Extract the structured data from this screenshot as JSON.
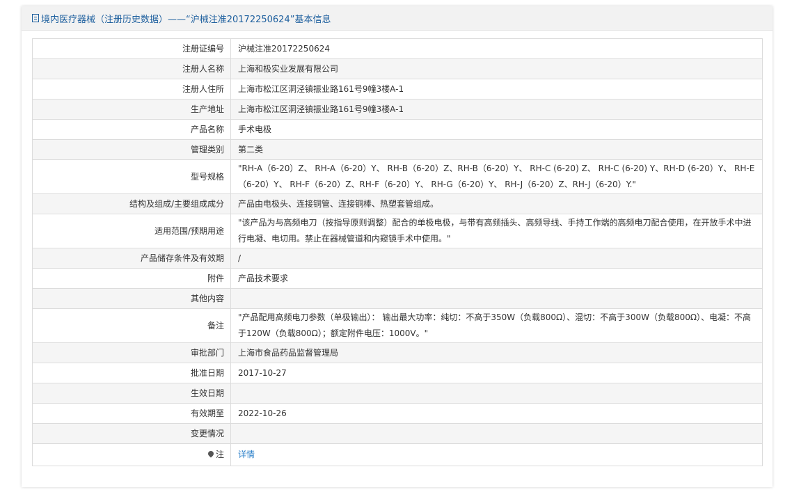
{
  "header": {
    "title": "境内医疗器械（注册历史数据）——“沪械注准20172250624”基本信息"
  },
  "rows": [
    {
      "label": "注册证编号",
      "value": "沪械注准20172250624"
    },
    {
      "label": "注册人名称",
      "value": "上海和极实业发展有限公司"
    },
    {
      "label": "注册人住所",
      "value": "上海市松江区洞泾镇振业路161号9幢3楼A-1"
    },
    {
      "label": "生产地址",
      "value": "上海市松江区洞泾镇振业路161号9幢3楼A-1"
    },
    {
      "label": "产品名称",
      "value": "手术电极"
    },
    {
      "label": "管理类别",
      "value": "第二类"
    },
    {
      "label": "型号规格",
      "value": "\"RH-A（6-20）Z、 RH-A（6-20）Y、 RH-B（6-20）Z、RH-B（6-20）Y、 RH-C (6-20) Z、 RH-C (6-20) Y、RH-D (6-20）Y、 RH-E（6-20）Y、 RH-F（6-20）Z、RH-F（6-20）Y、 RH-G（6-20）Y、 RH-J（6-20）Z、RH-J（6-20）Y.\""
    },
    {
      "label": "结构及组成/主要组成成分",
      "value": "产品由电极头、连接铜管、连接铜棒、热塑套管组成。"
    },
    {
      "label": "适用范围/预期用途",
      "value": "\"该产品为与高频电刀（按指导原则调整）配合的单极电极，与带有高频插头、高频导线、手持工作端的高频电刀配合使用，在开放手术中进行电凝、电切用。禁止在器械管道和内窥镜手术中使用。\""
    },
    {
      "label": "产品储存条件及有效期",
      "value": "/"
    },
    {
      "label": "附件",
      "value": "产品技术要求"
    },
    {
      "label": "其他内容",
      "value": ""
    },
    {
      "label": "备注",
      "value": "\"产品配用高频电刀参数（单极输出）： 输出最大功率：纯切：不高于350W（负载800Ω）、混切：不高于300W（负载800Ω）、电凝：不高于120W（负载800Ω）；额定附件电压：1000V。\""
    },
    {
      "label": "审批部门",
      "value": "上海市食品药品监督管理局"
    },
    {
      "label": "批准日期",
      "value": "2017-10-27"
    },
    {
      "label": "生效日期",
      "value": ""
    },
    {
      "label": "有效期至",
      "value": "2022-10-26"
    },
    {
      "label": "变更情况",
      "value": ""
    }
  ],
  "note": {
    "label": "注",
    "icon": "map-pin-icon",
    "link_text": "详情"
  },
  "colors": {
    "header_text": "#1d5f9e",
    "link": "#2a7fc9",
    "row_alt": "#f5f5f5",
    "border": "#dcdcdc"
  }
}
